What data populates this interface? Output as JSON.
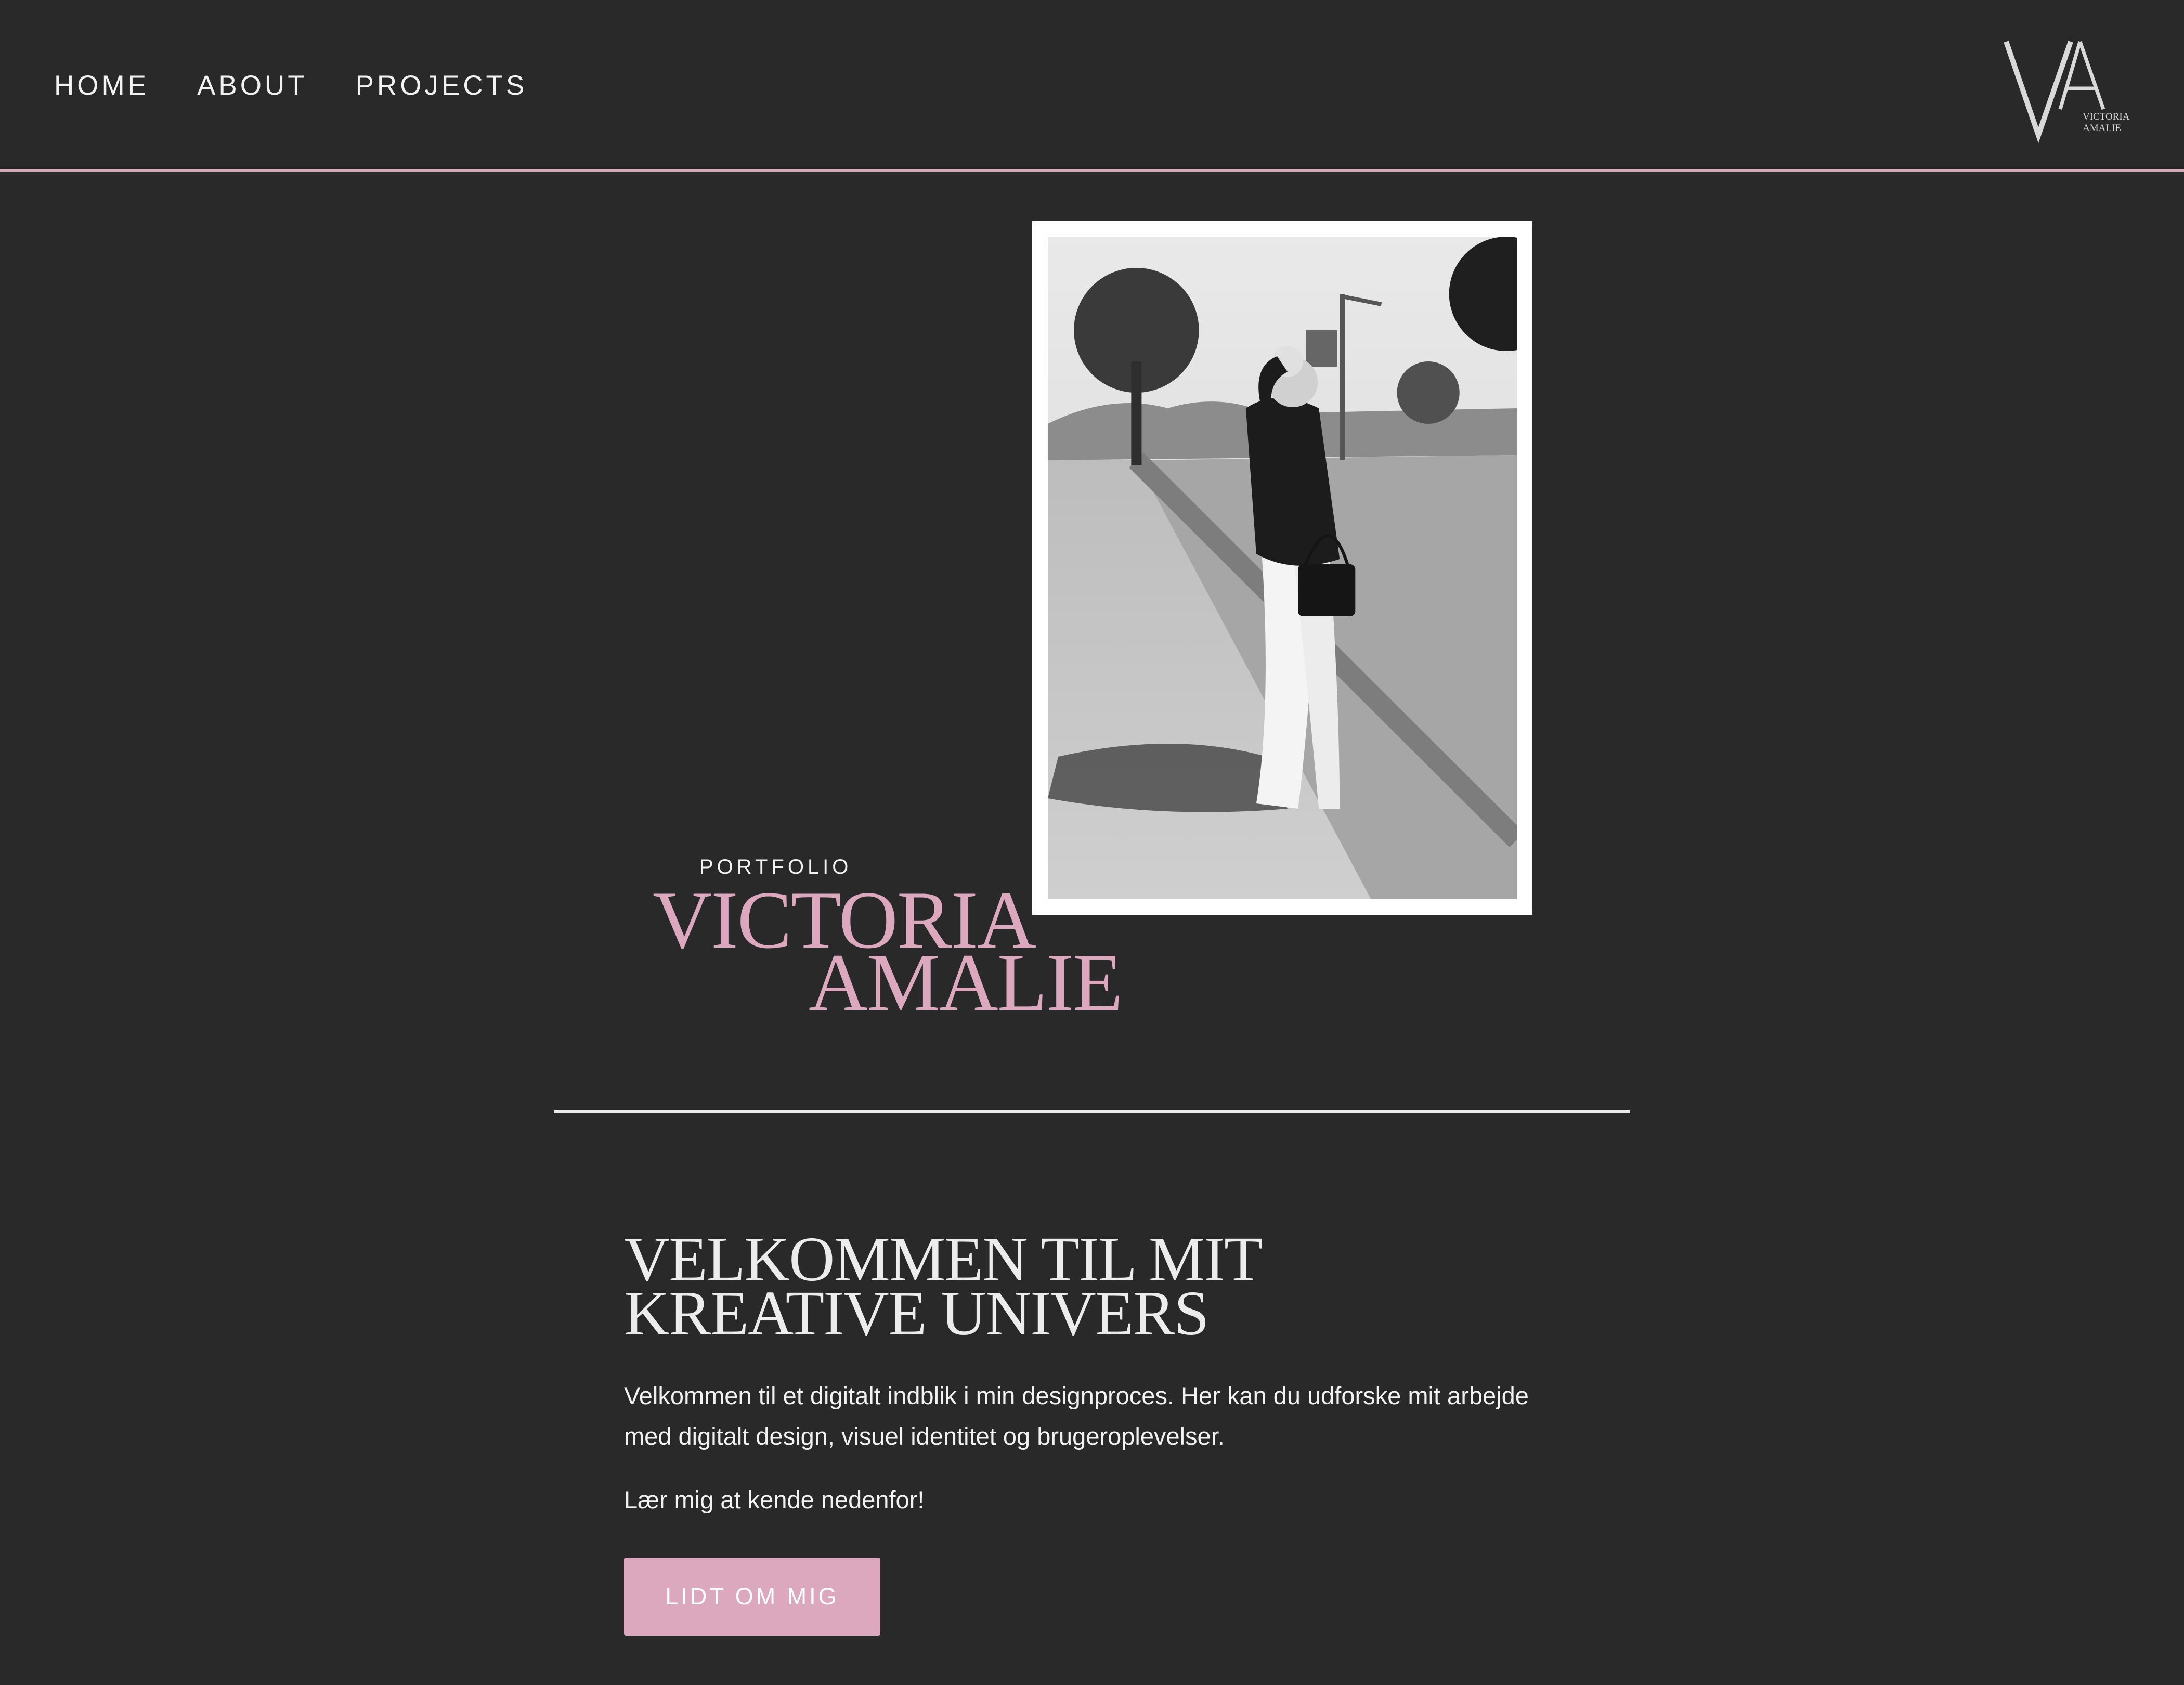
{
  "nav": {
    "items": [
      {
        "label": "HOME"
      },
      {
        "label": "ABOUT"
      },
      {
        "label": "PROJECTS"
      }
    ]
  },
  "logo": {
    "initials": "VA",
    "line1": "VICTORIA",
    "line2": "AMALIE"
  },
  "hero": {
    "kicker": "PORTFOLIO",
    "name_line1": "VICTORIA",
    "name_line2": "AMALIE",
    "photo_alt": "Black and white photo of a woman standing on a sidewalk"
  },
  "welcome": {
    "title_line1": "VELKOMMEN TIL MIT",
    "title_line2": "KREATIVE UNIVERS",
    "paragraph": "Velkommen til et digitalt indblik i min designproces. Her kan du udforske mit arbejde med digitalt design, visuel identitet og brugeroplevelser.",
    "invite": "Lær mig at kende nedenfor!",
    "button_label": "LIDT OM MIG"
  },
  "colors": {
    "background": "#292929",
    "accent_pink": "#dba8bd",
    "text": "#f2f2f2"
  }
}
